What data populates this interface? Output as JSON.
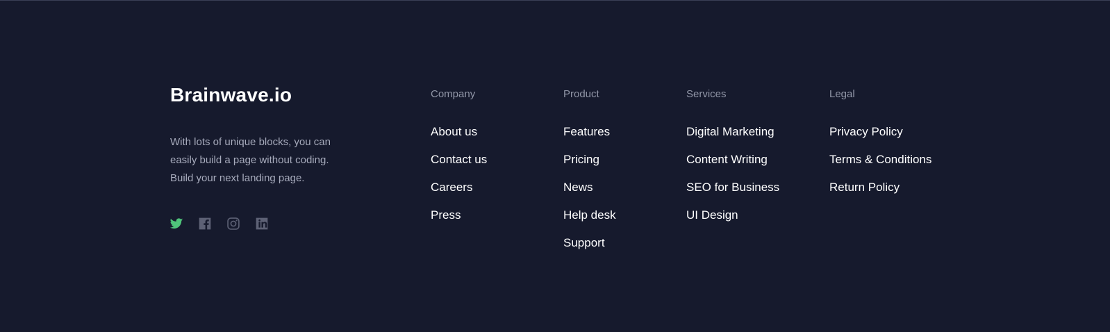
{
  "brand": {
    "name": "Brainwave.io",
    "description_lines": [
      "With lots of unique blocks, you can",
      "easily build a page without coding.",
      "Build your next landing page."
    ]
  },
  "social": [
    {
      "icon": "twitter-icon",
      "color": "#4fc47a"
    },
    {
      "icon": "facebook-icon",
      "color": "#5d6175"
    },
    {
      "icon": "instagram-icon",
      "color": "#5d6175"
    },
    {
      "icon": "linkedin-icon",
      "color": "#5d6175"
    }
  ],
  "columns": [
    {
      "title": "Company",
      "links": [
        "About us",
        "Contact us",
        "Careers",
        "Press"
      ]
    },
    {
      "title": "Product",
      "links": [
        "Features",
        "Pricing",
        "News",
        "Help desk",
        "Support"
      ]
    },
    {
      "title": "Services",
      "links": [
        "Digital Marketing",
        "Content Writing",
        "SEO for Business",
        "UI Design"
      ]
    },
    {
      "title": "Legal",
      "links": [
        "Privacy Policy",
        "Terms & Conditions",
        "Return Policy"
      ]
    }
  ],
  "colors": {
    "background": "#161a2d",
    "heading": "#9297a8",
    "link": "#ffffff",
    "accent": "#4fc47a",
    "icon_muted": "#5d6175"
  }
}
